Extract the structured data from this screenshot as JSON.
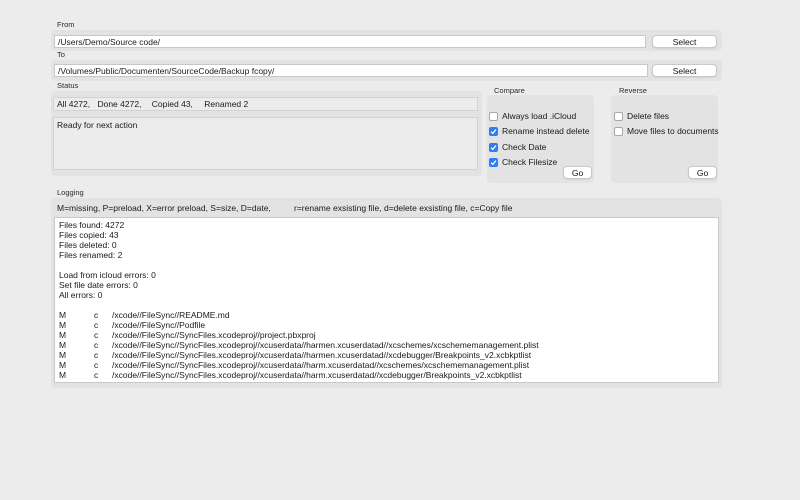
{
  "from": {
    "caption": "From",
    "path": "/Users/Demo/Source code/",
    "button": "Select"
  },
  "to": {
    "caption": "To",
    "path": "/Volumes/Public/Documenten/SourceCode/Backup fcopy/",
    "button": "Select"
  },
  "status": {
    "caption": "Status",
    "counts": {
      "all": "All 4272,",
      "done": "Done 4272,",
      "copied": "Copied 43,",
      "renamed": "Renamed 2"
    },
    "message": "Ready for next action"
  },
  "compare": {
    "caption": "Compare",
    "options": [
      {
        "label": "Always load .iCloud",
        "checked": false
      },
      {
        "label": "Rename instead delete",
        "checked": true
      },
      {
        "label": "Check Date",
        "checked": true
      },
      {
        "label": "Check Filesize",
        "checked": true
      }
    ],
    "go": "Go"
  },
  "reverse": {
    "caption": "Reverse",
    "options": [
      {
        "label": "Delete files",
        "checked": false
      },
      {
        "label": "Move files to documents",
        "checked": false
      }
    ],
    "go": "Go"
  },
  "logging": {
    "caption": "Logging",
    "legend_left": "M=missing, P=preload, X=error preload, S=size, D=date,",
    "legend_right": "r=rename exsisting file, d=delete exsisting file, c=Copy file",
    "summary": [
      "Files found: 4272",
      "Files copied: 43",
      "Files deleted: 0",
      "Files renamed: 2"
    ],
    "errors": [
      "Load from icloud errors: 0",
      "Set file date errors: 0",
      "All errors: 0"
    ],
    "entries": [
      {
        "flag": "M",
        "action": "c",
        "path": "/xcode//FileSync//README.md"
      },
      {
        "flag": "M",
        "action": "c",
        "path": "/xcode//FileSync//Podfile"
      },
      {
        "flag": "M",
        "action": "c",
        "path": "/xcode//FileSync//SyncFiles.xcodeproj//project.pbxproj"
      },
      {
        "flag": "M",
        "action": "c",
        "path": "/xcode//FileSync//SyncFiles.xcodeproj//xcuserdata//harmen.xcuserdatad//xcschemes/xcschememanagement.plist"
      },
      {
        "flag": "M",
        "action": "c",
        "path": "/xcode//FileSync//SyncFiles.xcodeproj//xcuserdata//harmen.xcuserdatad//xcdebugger/Breakpoints_v2.xcbkptlist"
      },
      {
        "flag": "M",
        "action": "c",
        "path": "/xcode//FileSync//SyncFiles.xcodeproj//xcuserdata//harm.xcuserdatad//xcschemes/xcschememanagement.plist"
      },
      {
        "flag": "M",
        "action": "c",
        "path": "/xcode//FileSync//SyncFiles.xcodeproj//xcuserdata//harm.xcuserdatad//xcdebugger/Breakpoints_v2.xcbkptlist"
      }
    ]
  },
  "colors": {
    "window_bg": "#ececec",
    "group_bg": "#e3e3e3",
    "checkbox_on": "#2f7bf5"
  }
}
